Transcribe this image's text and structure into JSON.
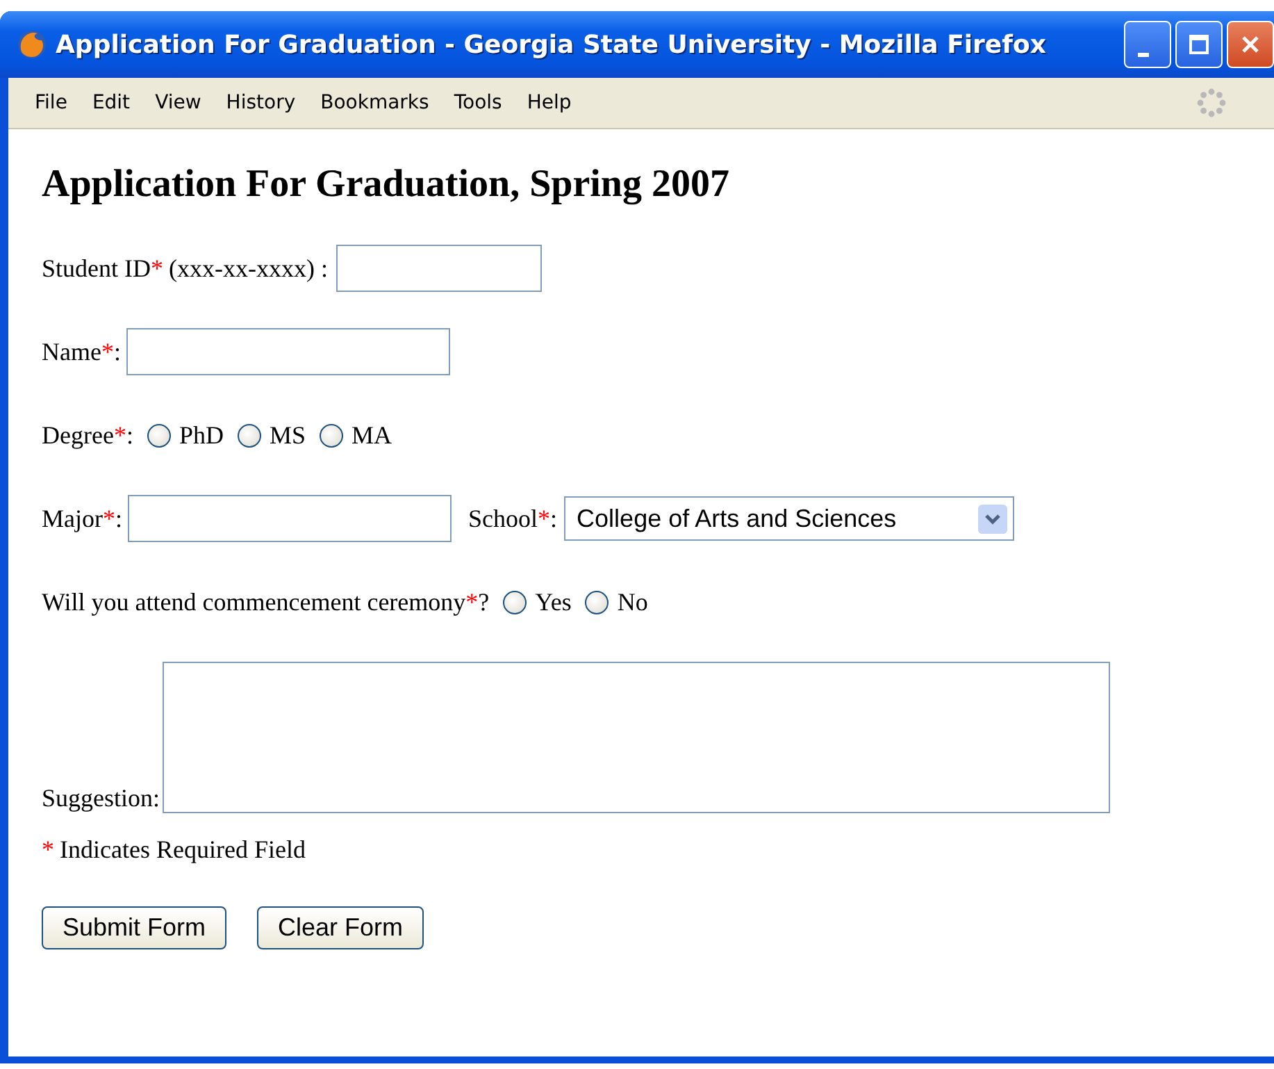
{
  "window": {
    "title": "Application For Graduation - Georgia State University - Mozilla Firefox"
  },
  "menu": [
    "File",
    "Edit",
    "View",
    "History",
    "Bookmarks",
    "Tools",
    "Help"
  ],
  "heading": "Application For Graduation, Spring 2007",
  "fields": [
    {
      "kind": "text",
      "label": "Student ID",
      "mark": "*",
      "hint": "(xxx-xx-xxxx) :"
    },
    {
      "kind": "text",
      "label": "Name",
      "mark": "*",
      "hint": ":"
    },
    {
      "kind": "radio",
      "label": "Degree",
      "mark": "*",
      "hint": ":",
      "options": [
        {
          "label": "PhD",
          "selected": false
        },
        {
          "label": "MS",
          "selected": false
        },
        {
          "label": "MA",
          "selected": false
        }
      ]
    },
    {
      "kind": "major",
      "label": "Major",
      "mark": "*",
      "hint": ":",
      "label2": "School",
      "mark2": "*",
      "hint2": ":",
      "select_value": "College of Arts and Sciences"
    },
    {
      "kind": "radio",
      "label": "Will you attend commencement ceremony",
      "mark": "*",
      "hint": "?",
      "options": [
        {
          "label": "Yes",
          "selected": false
        },
        {
          "label": "No",
          "selected": false
        }
      ]
    },
    {
      "kind": "textarea",
      "label": "Suggestion:"
    }
  ],
  "note": {
    "mark": "*",
    "text": "Indicates Required Field"
  },
  "buttons": [
    "Submit Form",
    "Clear Form"
  ]
}
